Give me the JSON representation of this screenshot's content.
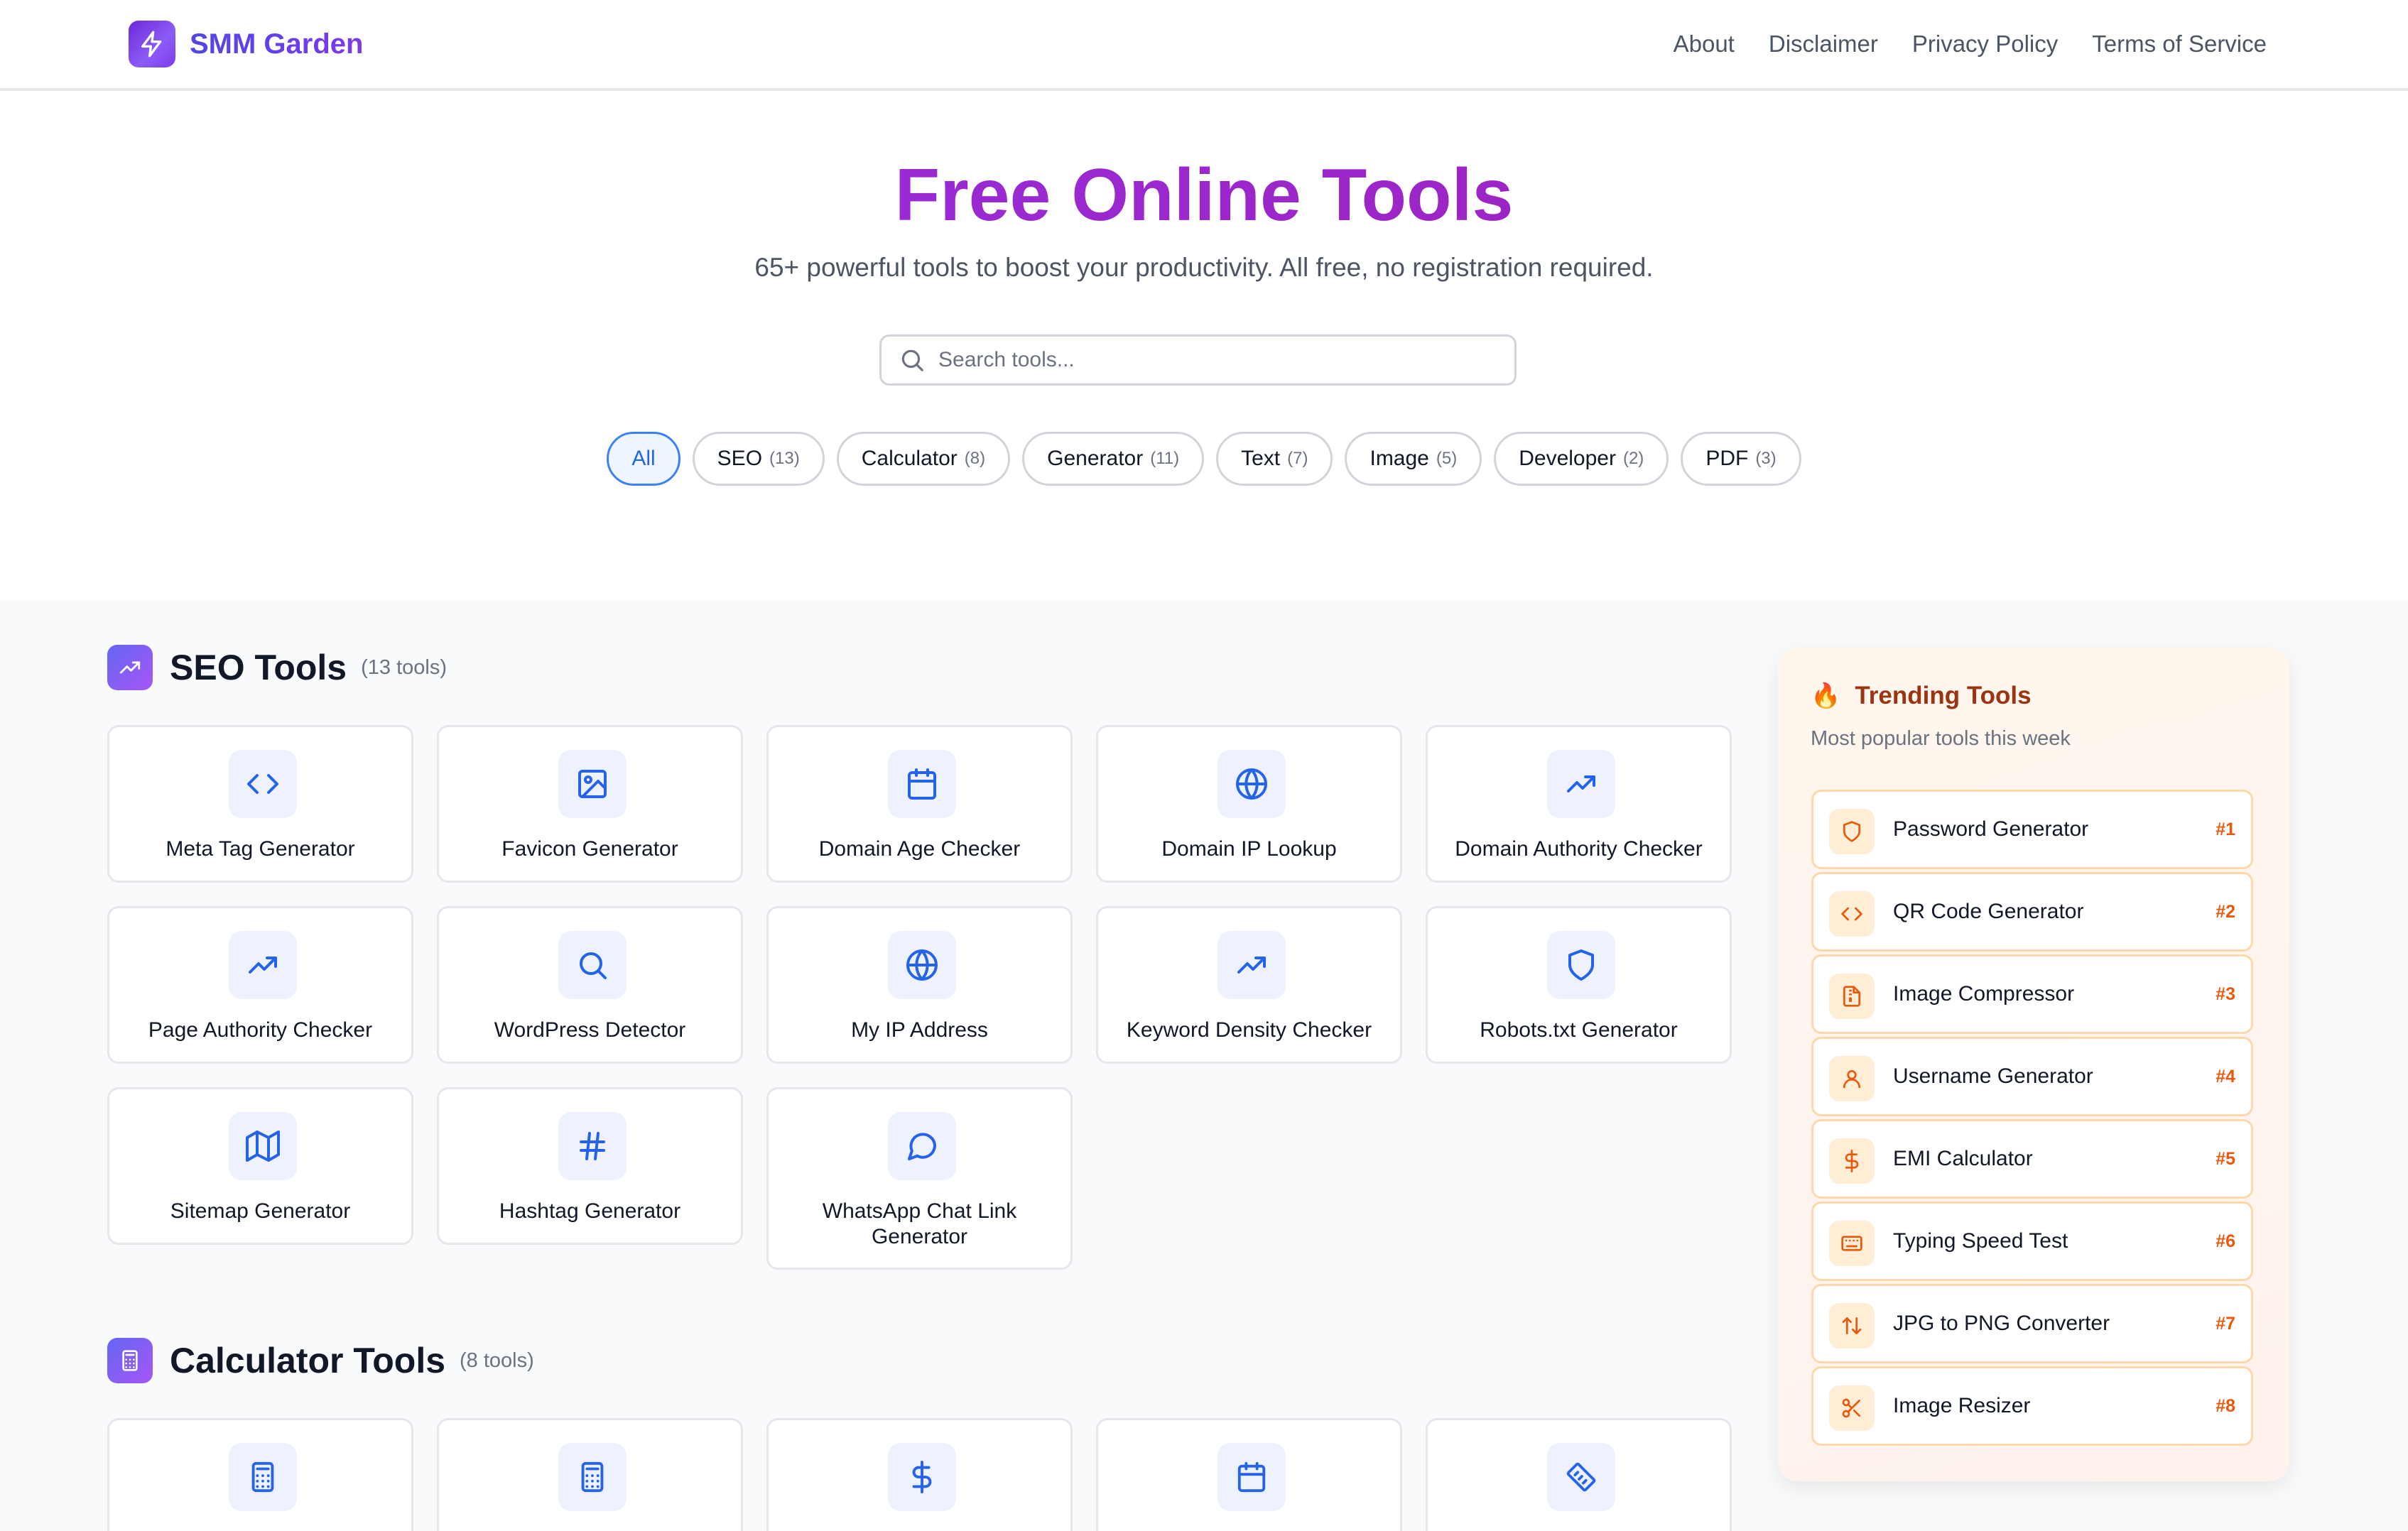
{
  "brand": {
    "name": "SMM Garden",
    "icon": "lightning-icon"
  },
  "nav": {
    "links": [
      "About",
      "Disclaimer",
      "Privacy Policy",
      "Terms of Service"
    ]
  },
  "hero": {
    "title": "Free Online Tools",
    "subtitle": "65+ powerful tools to boost your productivity. All free, no registration required.",
    "search_placeholder": "Search tools..."
  },
  "filters": [
    {
      "label": "All",
      "count": "",
      "active": true
    },
    {
      "label": "SEO",
      "count": "(13)"
    },
    {
      "label": "Calculator",
      "count": "(8)"
    },
    {
      "label": "Generator",
      "count": "(11)"
    },
    {
      "label": "Text",
      "count": "(7)"
    },
    {
      "label": "Image",
      "count": "(5)"
    },
    {
      "label": "Developer",
      "count": "(2)"
    },
    {
      "label": "PDF",
      "count": "(3)"
    }
  ],
  "seo": {
    "title": "SEO Tools",
    "count": "(13 tools)",
    "icon": "trending-up-icon",
    "tools": [
      {
        "label": "Meta Tag Generator",
        "icon": "code-icon"
      },
      {
        "label": "Favicon Generator",
        "icon": "image-icon"
      },
      {
        "label": "Domain Age Checker",
        "icon": "calendar-icon"
      },
      {
        "label": "Domain IP Lookup",
        "icon": "globe-icon"
      },
      {
        "label": "Domain Authority Checker",
        "icon": "trending-up-icon"
      },
      {
        "label": "Page Authority Checker",
        "icon": "trending-up-icon"
      },
      {
        "label": "WordPress Detector",
        "icon": "search-icon"
      },
      {
        "label": "My IP Address",
        "icon": "globe-icon"
      },
      {
        "label": "Keyword Density Checker",
        "icon": "trending-up-icon"
      },
      {
        "label": "Robots.txt Generator",
        "icon": "shield-icon"
      },
      {
        "label": "Sitemap Generator",
        "icon": "map-icon"
      },
      {
        "label": "Hashtag Generator",
        "icon": "hash-icon"
      },
      {
        "label": "WhatsApp Chat Link Generator",
        "icon": "message-icon"
      }
    ]
  },
  "calculator": {
    "title": "Calculator Tools",
    "count": "(8 tools)",
    "icon": "calculator-icon",
    "tools": [
      {
        "label": "",
        "icon": "calculator-icon"
      },
      {
        "label": "",
        "icon": "calculator-icon"
      },
      {
        "label": "",
        "icon": "dollar-icon"
      },
      {
        "label": "",
        "icon": "calendar-icon"
      },
      {
        "label": "",
        "icon": "ruler-icon"
      }
    ]
  },
  "trending": {
    "title": "Trending Tools",
    "subtitle": "Most popular tools this week",
    "items": [
      {
        "name": "Password Generator",
        "rank": "#1",
        "icon": "shield-icon"
      },
      {
        "name": "QR Code Generator",
        "rank": "#2",
        "icon": "code-icon"
      },
      {
        "name": "Image Compressor",
        "rank": "#3",
        "icon": "file-archive-icon"
      },
      {
        "name": "Username Generator",
        "rank": "#4",
        "icon": "user-icon"
      },
      {
        "name": "EMI Calculator",
        "rank": "#5",
        "icon": "dollar-icon"
      },
      {
        "name": "Typing Speed Test",
        "rank": "#6",
        "icon": "keyboard-icon"
      },
      {
        "name": "JPG to PNG Converter",
        "rank": "#7",
        "icon": "arrows-updown-icon"
      },
      {
        "name": "Image Resizer",
        "rank": "#8",
        "icon": "scissors-icon"
      }
    ]
  },
  "colors": {
    "accent_blue": "#2563eb",
    "brand_purple": "#7c3aed",
    "trending_orange": "#ea580c"
  }
}
